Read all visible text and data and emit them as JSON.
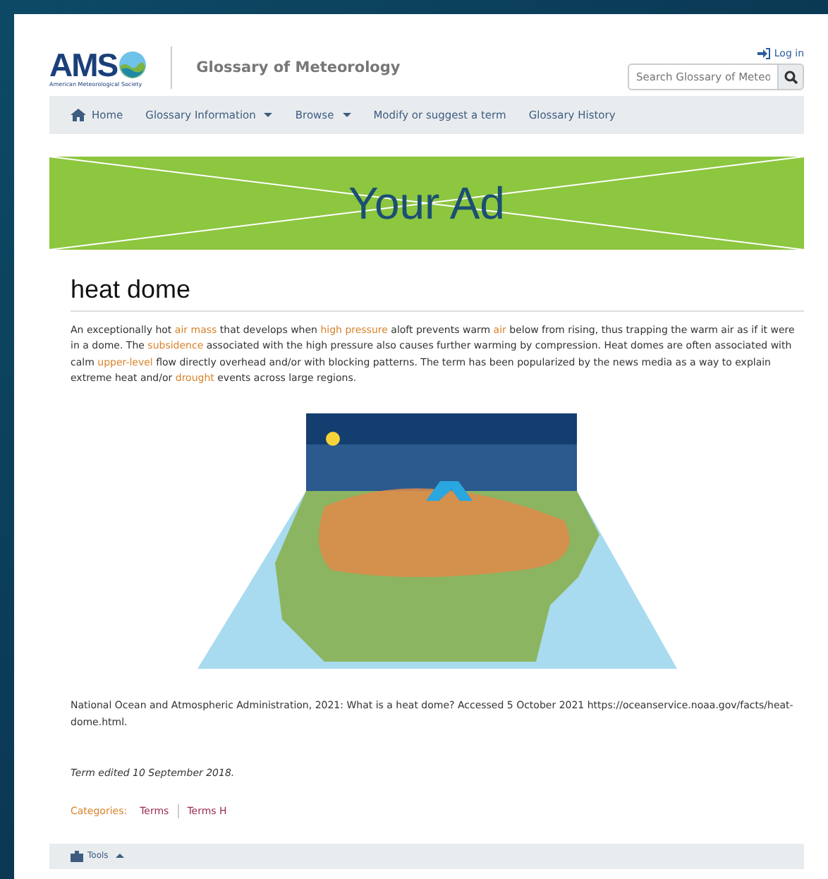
{
  "header": {
    "logo": "AMS",
    "logo_subtitle": "American Meteorological Society",
    "site_title": "Glossary of Meteorology",
    "login": "Log in",
    "search": {
      "placeholder": "Search Glossary of Meteo"
    }
  },
  "nav": [
    {
      "label": "Home",
      "kind": "home"
    },
    {
      "label": "Glossary Information",
      "kind": "dropdown"
    },
    {
      "label": "Browse",
      "kind": "dropdown"
    },
    {
      "label": "Modify or suggest a term",
      "kind": "plain"
    },
    {
      "label": "Glossary History",
      "kind": "plain"
    }
  ],
  "ad": {
    "text": "Your Ad"
  },
  "term": {
    "title": "heat dome",
    "definition": [
      {
        "text": "An exceptionally hot ",
        "link": false
      },
      {
        "text": "air mass",
        "link": true
      },
      {
        "text": " that develops when ",
        "link": false
      },
      {
        "text": "high pressure",
        "link": true
      },
      {
        "text": " aloft prevents warm ",
        "link": false
      },
      {
        "text": "air",
        "link": true
      },
      {
        "text": " below from rising, thus trapping the warm air as if it were in a dome. The ",
        "link": false
      },
      {
        "text": "subsidence",
        "link": true
      },
      {
        "text": " associated with the high pressure also causes further warming by compression. Heat domes are often associated with calm ",
        "link": false
      },
      {
        "text": "upper-level",
        "link": true
      },
      {
        "text": " flow directly overhead and/or with blocking patterns. The term has been popularized by the news media as a way to explain extreme heat and/or ",
        "link": false
      },
      {
        "text": "drought",
        "link": true
      },
      {
        "text": " events across large regions.",
        "link": false
      }
    ],
    "citation": "National Ocean and Atmospheric Administration, 2021: What is a heat dome? Accessed 5 October 2021 https://oceanservice.noaa.gov/facts/heat-dome.html.",
    "edited": "Term edited 10 September 2018."
  },
  "categories": {
    "label": "Categories:",
    "items": [
      "Terms",
      "Terms H"
    ]
  },
  "tools": {
    "label": "Tools"
  }
}
